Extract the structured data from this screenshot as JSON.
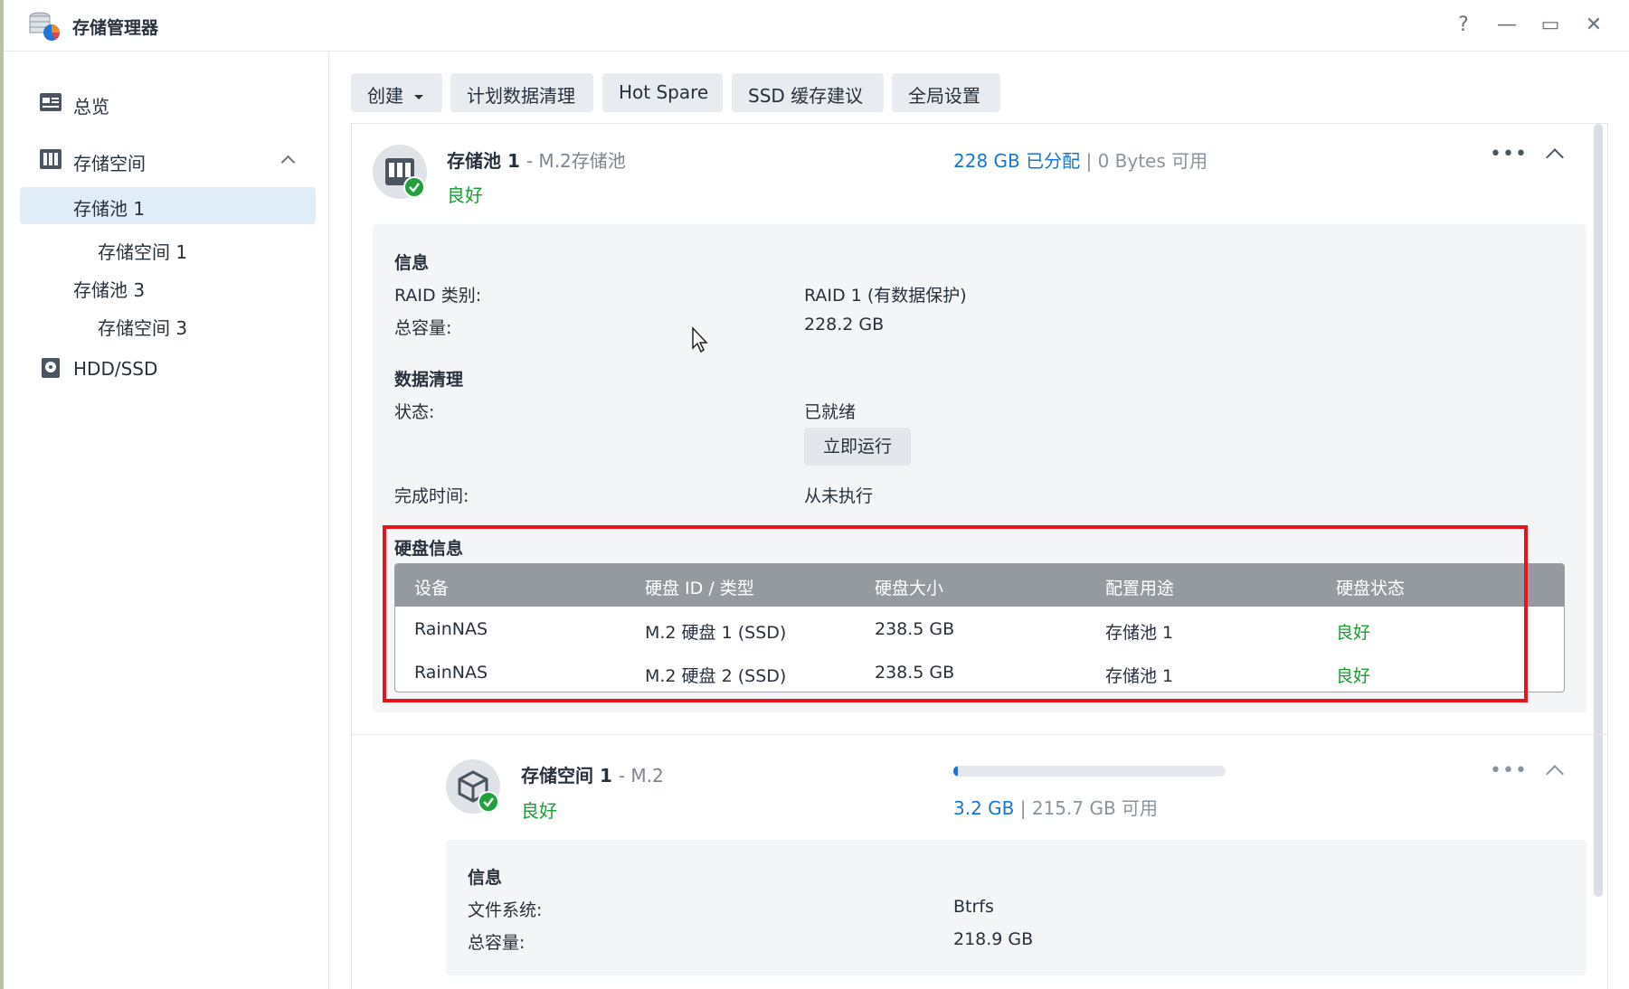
{
  "window": {
    "title": "存储管理器",
    "help": "?",
    "minimize": "—",
    "maximize": "▭",
    "close": "✕"
  },
  "sidebar": {
    "overview": "总览",
    "storage": "存储空间",
    "pool1": "存储池 1",
    "volume1": "存储空间 1",
    "pool3": "存储池 3",
    "volume3": "存储空间 3",
    "hdd": "HDD/SSD"
  },
  "toolbar": {
    "create": "创建",
    "scrub_schedule": "计划数据清理",
    "hot_spare": "Hot Spare",
    "ssd_cache": "SSD 缓存建议",
    "global_settings": "全局设置"
  },
  "pool": {
    "name": "存储池 1",
    "type": "- M.2存储池",
    "status": "良好",
    "allocated": "228 GB 已分配",
    "separator": "|",
    "available": "0 Bytes 可用",
    "more": "•••",
    "info_title": "信息",
    "raid_label": "RAID 类别:",
    "raid_value": "RAID 1 (有数据保护)",
    "capacity_label": "总容量:",
    "capacity_value": "228.2 GB",
    "scrub_title": "数据清理",
    "scrub_status_label": "状态:",
    "scrub_status_value": "已就绪",
    "run_now": "立即运行",
    "finish_label": "完成时间:",
    "finish_value": "从未执行",
    "disk_title": "硬盘信息",
    "disk_headers": [
      "设备",
      "硬盘 ID / 类型",
      "硬盘大小",
      "配置用途",
      "硬盘状态"
    ],
    "disks": [
      [
        "RainNAS",
        "M.2 硬盘 1 (SSD)",
        "238.5 GB",
        "存储池 1",
        "良好"
      ],
      [
        "RainNAS",
        "M.2 硬盘 2 (SSD)",
        "238.5 GB",
        "存储池 1",
        "良好"
      ]
    ]
  },
  "volume": {
    "name": "存储空间 1",
    "type": "- M.2",
    "status": "良好",
    "used": "3.2 GB",
    "separator": "|",
    "available": "215.7 GB 可用",
    "usage_fraction": 0.015,
    "more": "•••",
    "info_title": "信息",
    "fs_label": "文件系统:",
    "fs_value": "Btrfs",
    "capacity_label": "总容量:",
    "capacity_value": "218.9 GB"
  },
  "colors": {
    "accent": "#1676d2",
    "good": "#16a031",
    "highlight": "#e8141d"
  }
}
